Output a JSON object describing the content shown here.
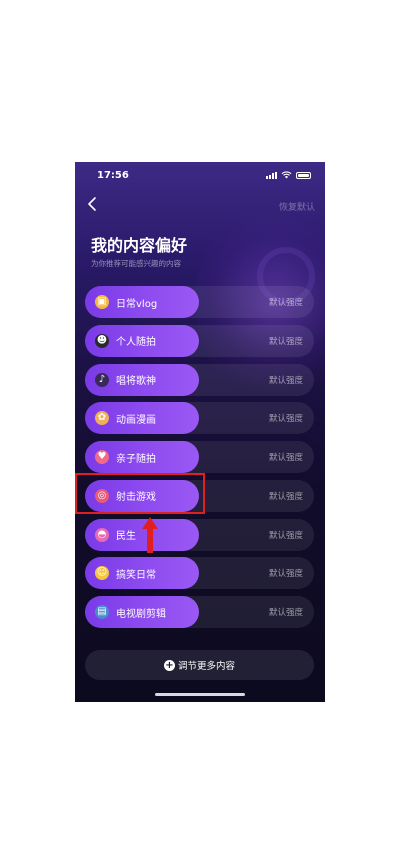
{
  "status": {
    "time": "17:56"
  },
  "header": {
    "restore_label": "恢复默认",
    "back_icon": "chevron-left-icon"
  },
  "page": {
    "title": "我的内容偏好",
    "subtitle": "为你推荐可能感兴趣的内容"
  },
  "preferences": [
    {
      "label": "日常vlog",
      "strength": "默认强度",
      "icon": "camera-icon",
      "color": "#f5b942"
    },
    {
      "label": "个人随拍",
      "strength": "默认强度",
      "icon": "selfie-icon",
      "color": "#f0f0f0"
    },
    {
      "label": "唱将歌神",
      "strength": "默认强度",
      "icon": "singer-icon",
      "color": "#ffffff"
    },
    {
      "label": "动画漫画",
      "strength": "默认强度",
      "icon": "cartoon-cat-icon",
      "color": "#f0b05a"
    },
    {
      "label": "亲子随拍",
      "strength": "默认强度",
      "icon": "family-icon",
      "color": "#f06a8a"
    },
    {
      "label": "射击游戏",
      "strength": "默认强度",
      "icon": "target-icon",
      "color": "#e85a7a"
    },
    {
      "label": "民生",
      "strength": "默认强度",
      "icon": "hat-icon",
      "color": "#e86ab0"
    },
    {
      "label": "搞笑日常",
      "strength": "默认强度",
      "icon": "laughing-face-icon",
      "color": "#f5c542"
    },
    {
      "label": "电视剧剪辑",
      "strength": "默认强度",
      "icon": "tv-drama-icon",
      "color": "#7ad0f0"
    }
  ],
  "footer": {
    "more_label": "调节更多内容"
  },
  "annotation": {
    "highlight_color": "#e02020",
    "highlighted_item": "射击游戏"
  }
}
